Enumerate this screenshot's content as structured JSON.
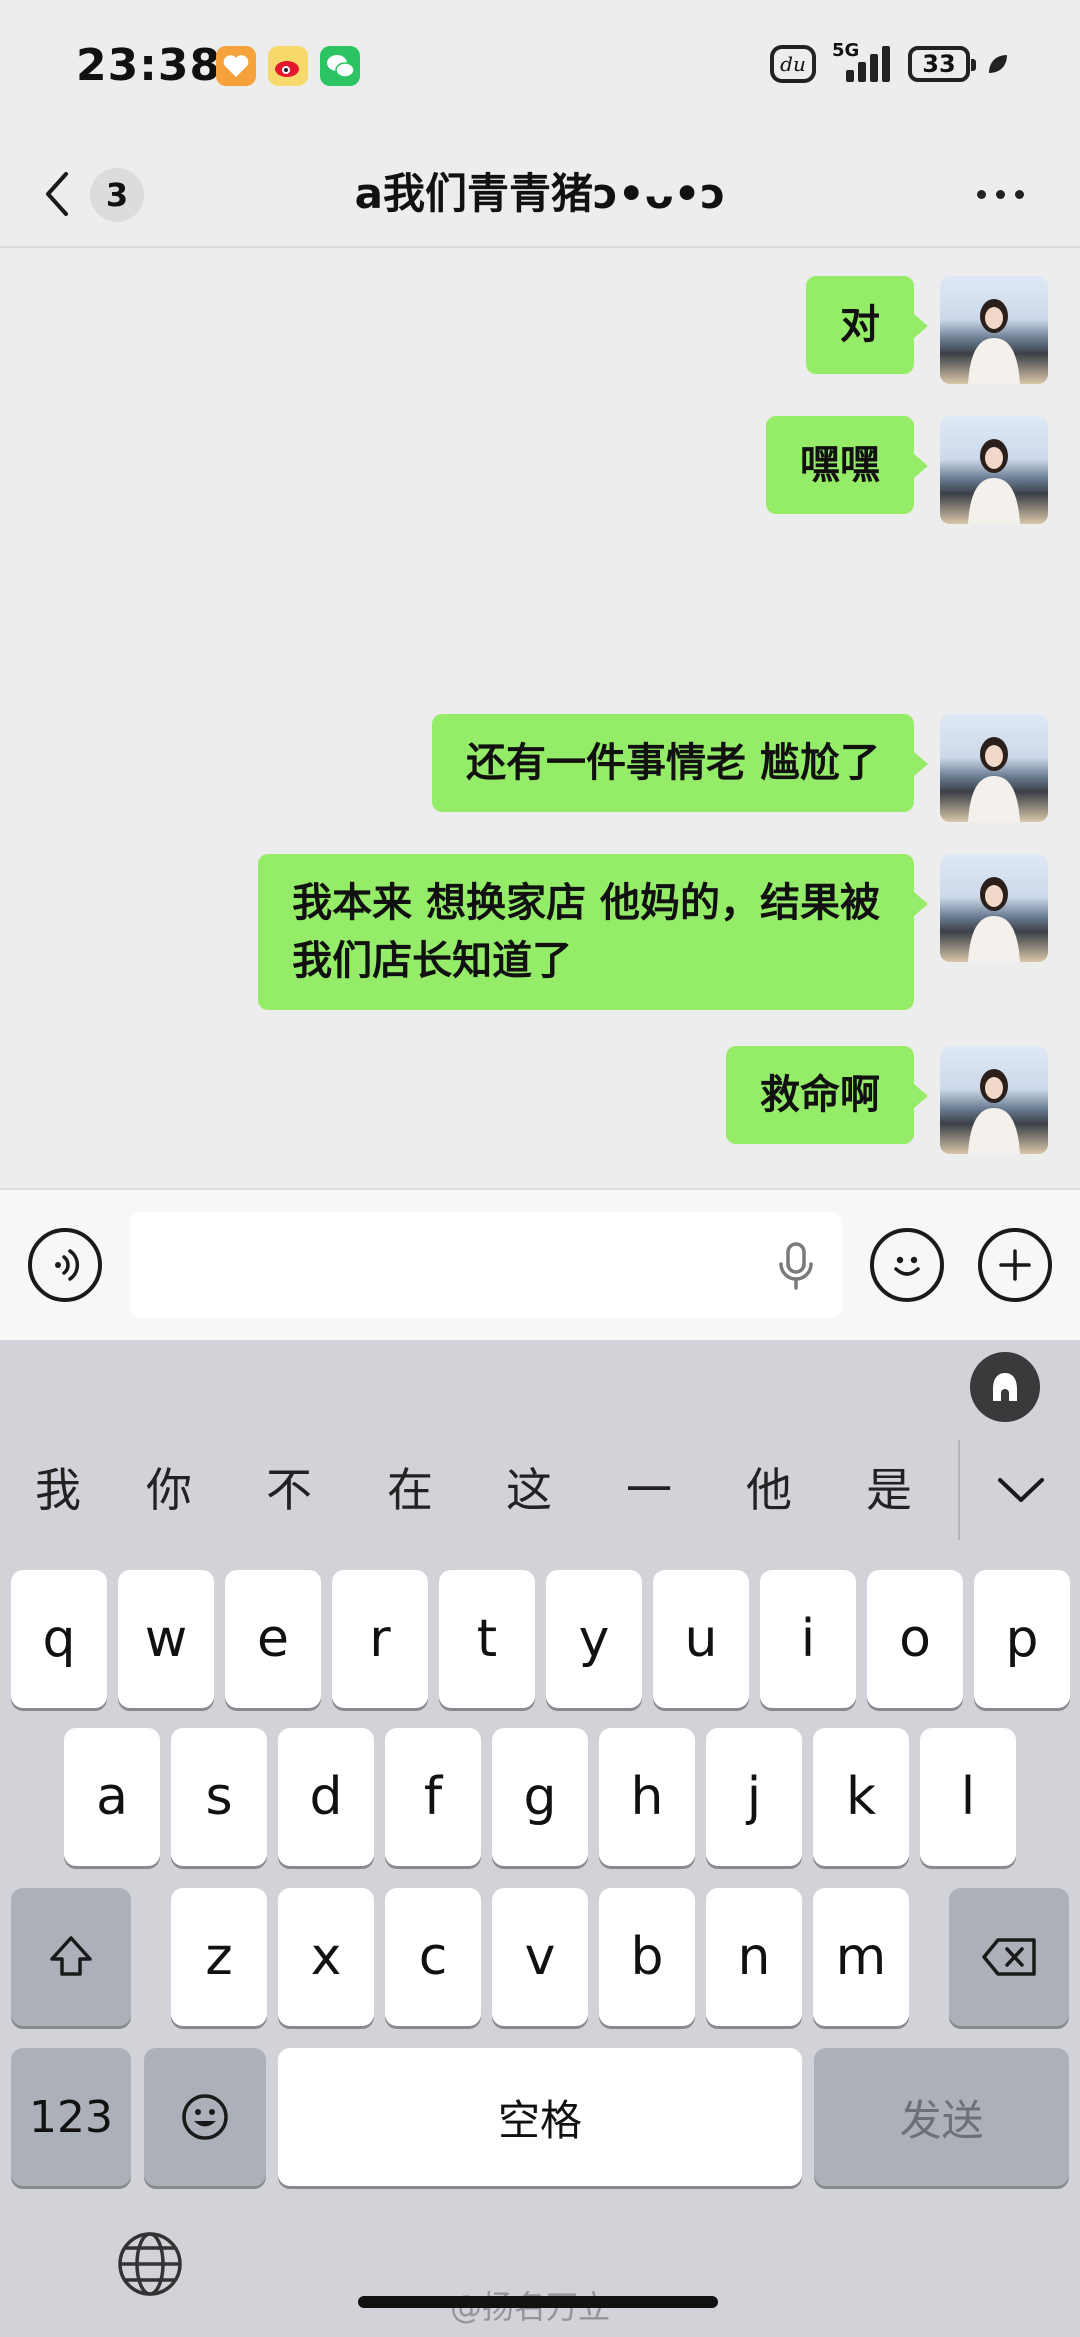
{
  "status_bar": {
    "time": "23:38",
    "network": "5G",
    "battery": "33",
    "app_icons": [
      "orange-heart-app-icon",
      "weibo-icon",
      "wechat-icon"
    ],
    "du_label": "du"
  },
  "header": {
    "back_badge": "3",
    "title": "a我们青青猪ↄ•ᴗ•ↄ"
  },
  "messages": [
    {
      "text": "对",
      "sender": "me"
    },
    {
      "text": "嘿嘿",
      "sender": "me"
    },
    {
      "text": "还有一件事情老 尴尬了",
      "sender": "me"
    },
    {
      "text": "我本来 想换家店 他妈的，结果被\n我们店长知道了",
      "sender": "me"
    },
    {
      "text": "救命啊",
      "sender": "me"
    }
  ],
  "input_bar": {
    "value": "",
    "voice_icon": "voice-icon",
    "emoji_icon": "emoji-icon",
    "plus_icon": "plus-icon"
  },
  "keyboard": {
    "candidates": [
      "我",
      "你",
      "不",
      "在",
      "这",
      "一",
      "他",
      "是"
    ],
    "row1": [
      "q",
      "w",
      "e",
      "r",
      "t",
      "y",
      "u",
      "i",
      "o",
      "p"
    ],
    "row2": [
      "a",
      "s",
      "d",
      "f",
      "g",
      "h",
      "j",
      "k",
      "l"
    ],
    "row3": [
      "z",
      "x",
      "c",
      "v",
      "b",
      "n",
      "m"
    ],
    "numbers_label": "123",
    "space_label": "空格",
    "send_label": "发送"
  },
  "watermark": "@扬名万立",
  "colors": {
    "chat_bg": "#ededed",
    "bubble": "#95ec69",
    "keyboard_bg": "#d1d3d9",
    "function_key": "#acb0b9"
  }
}
